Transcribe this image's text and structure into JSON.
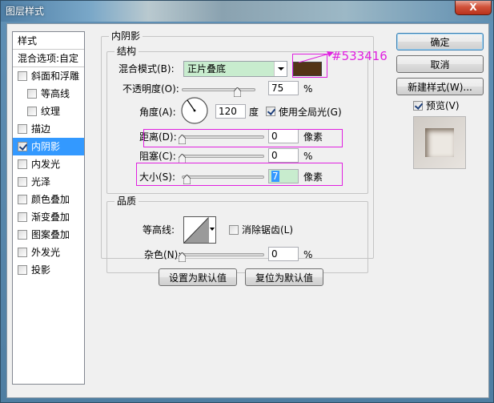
{
  "window": {
    "title": "图层样式",
    "close_label": "X"
  },
  "left_panel": {
    "header": "样式",
    "blend_options": "混合选项:自定",
    "items": [
      {
        "label": "斜面和浮雕",
        "checked": false,
        "indent": false
      },
      {
        "label": "等高线",
        "checked": false,
        "indent": true
      },
      {
        "label": "纹理",
        "checked": false,
        "indent": true
      },
      {
        "label": "描边",
        "checked": false,
        "indent": false
      },
      {
        "label": "内阴影",
        "checked": true,
        "indent": false,
        "selected": true
      },
      {
        "label": "内发光",
        "checked": false,
        "indent": false
      },
      {
        "label": "光泽",
        "checked": false,
        "indent": false
      },
      {
        "label": "颜色叠加",
        "checked": false,
        "indent": false
      },
      {
        "label": "渐变叠加",
        "checked": false,
        "indent": false
      },
      {
        "label": "图案叠加",
        "checked": false,
        "indent": false
      },
      {
        "label": "外发光",
        "checked": false,
        "indent": false
      },
      {
        "label": "投影",
        "checked": false,
        "indent": false
      }
    ]
  },
  "inner_shadow": {
    "group_title": "内阴影",
    "structure": {
      "title": "结构",
      "blend_mode_label": "混合模式(B):",
      "blend_mode_value": "正片叠底",
      "color_hex": "#533416",
      "opacity_label": "不透明度(O):",
      "opacity_value": "75",
      "opacity_unit": "%",
      "opacity_fraction": 0.75,
      "angle_label": "角度(A):",
      "angle_value": "120",
      "angle_unit": "度",
      "use_global_light_label": "使用全局光(G)",
      "use_global_light": true,
      "distance_label": "距离(D):",
      "distance_value": "0",
      "distance_unit": "像素",
      "choke_label": "阻塞(C):",
      "choke_value": "0",
      "choke_unit": "%",
      "size_label": "大小(S):",
      "size_value": "7",
      "size_unit": "像素"
    },
    "quality": {
      "title": "品质",
      "contour_label": "等高线:",
      "anti_alias_label": "消除锯齿(L)",
      "anti_alias": false,
      "noise_label": "杂色(N):",
      "noise_value": "0",
      "noise_unit": "%"
    },
    "make_default_label": "设置为默认值",
    "reset_default_label": "复位为默认值"
  },
  "right_buttons": {
    "ok_label": "确定",
    "cancel_label": "取消",
    "new_style_label": "新建样式(W)...",
    "preview_label": "预览(V)",
    "preview_checked": true
  },
  "annotation": {
    "color_hex_text": "#533416",
    "color": "#e020e0"
  }
}
